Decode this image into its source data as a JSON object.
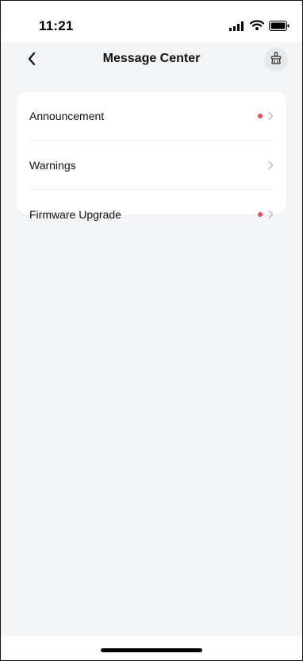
{
  "status_bar": {
    "time": "11:21",
    "icons": [
      "signal-icon",
      "wifi-icon",
      "battery-icon"
    ]
  },
  "nav": {
    "back_icon": "chevron-left-icon",
    "title": "Message Center",
    "clean_icon": "broom-icon"
  },
  "menu": {
    "items": [
      {
        "label": "Announcement",
        "has_unread_dot": true
      },
      {
        "label": "Warnings",
        "has_unread_dot": false
      },
      {
        "label": "Firmware Upgrade",
        "has_unread_dot": true
      }
    ]
  },
  "colors": {
    "background": "#f4f5f7",
    "card": "#ffffff",
    "unread_dot": "#f04657",
    "chevron": "#b8bcc2",
    "text": "#111111"
  }
}
